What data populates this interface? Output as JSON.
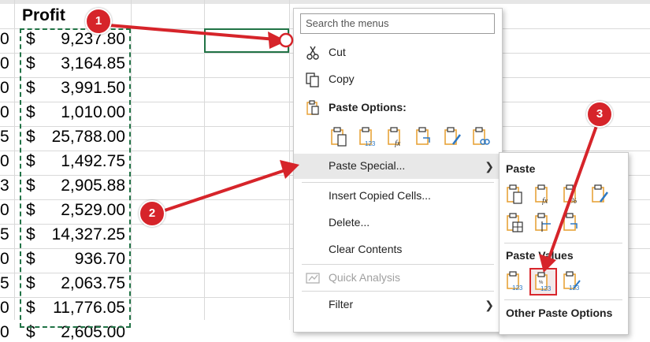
{
  "sheet": {
    "header_label": "Profit",
    "currency_symbol": "$",
    "left_edge_digits": [
      "0",
      "0",
      "0",
      "0",
      "5",
      "0",
      "3",
      "0",
      "5",
      "0",
      "5",
      "0",
      "0"
    ],
    "profits": [
      "9,237.80",
      "3,164.85",
      "3,991.50",
      "1,010.00",
      "25,788.00",
      "1,492.75",
      "2,905.88",
      "2,529.00",
      "14,327.25",
      "936.70",
      "2,063.75",
      "11,776.05",
      "2,605.00"
    ]
  },
  "context_menu": {
    "search_placeholder": "Search the menus",
    "cut": "Cut",
    "copy": "Copy",
    "paste_options": "Paste Options:",
    "paste_special": "Paste Special...",
    "insert_copied": "Insert Copied Cells...",
    "delete": "Delete...",
    "clear_contents": "Clear Contents",
    "quick_analysis": "Quick Analysis",
    "filter": "Filter"
  },
  "submenu": {
    "paste": "Paste",
    "paste_values": "Paste Values",
    "other_paste_options": "Other Paste Options"
  },
  "annotations": {
    "step1": "1",
    "step2": "2",
    "step3": "3",
    "color": "#d6242a"
  },
  "colors": {
    "excel_green": "#217346",
    "icon_orange": "#e8a33a",
    "icon_blue": "#2b78c5"
  }
}
